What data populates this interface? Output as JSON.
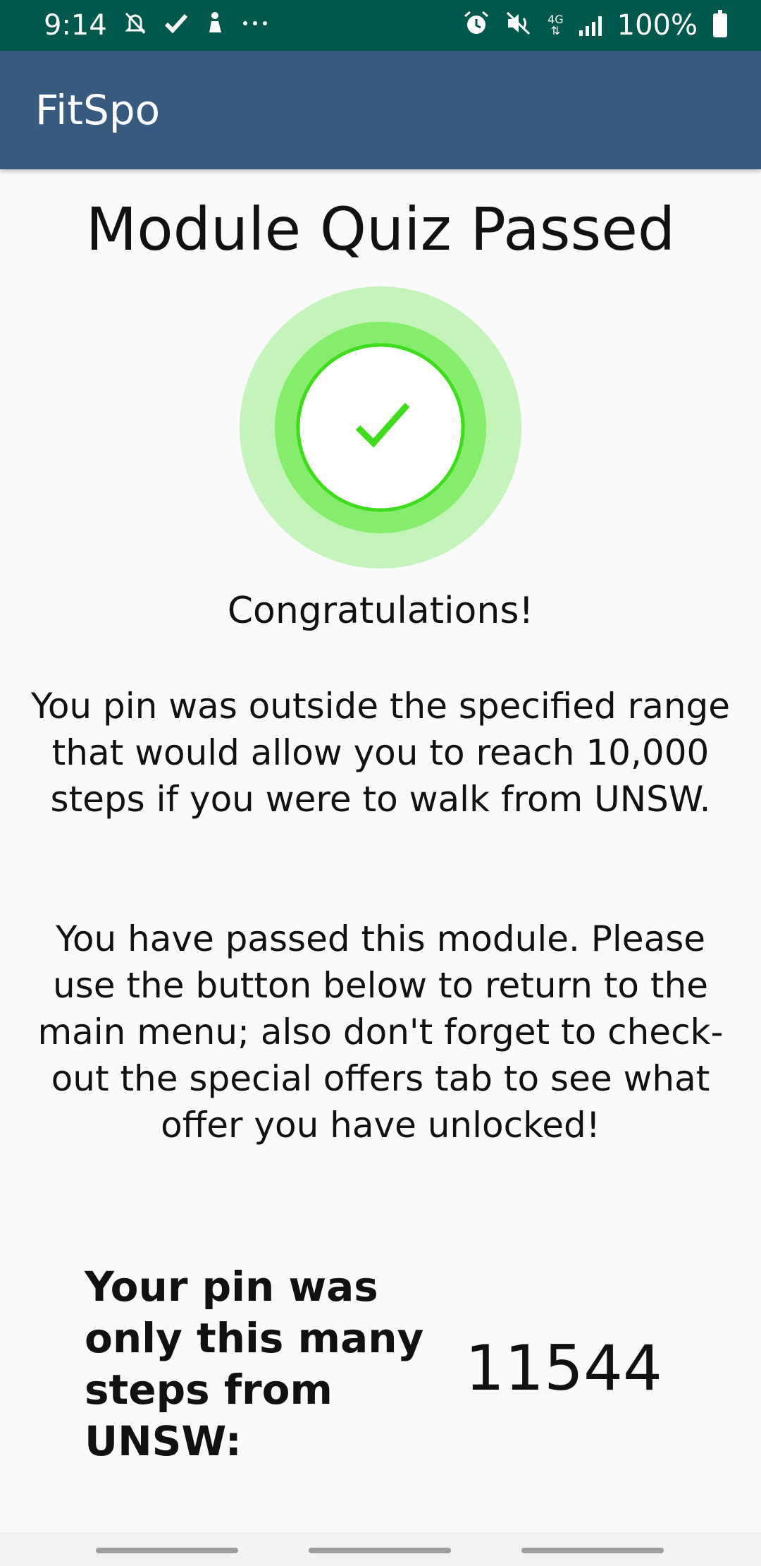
{
  "status_bar": {
    "time": "9:14",
    "left_icons": [
      "notifications-off-icon",
      "check-icon",
      "accessibility-icon",
      "more-icon"
    ],
    "right_icons": [
      "alarm-icon",
      "vibrate-icon",
      "network-4g-icon",
      "signal-icon",
      "battery-icon"
    ],
    "network_label": "4G",
    "battery": "100%"
  },
  "app_bar": {
    "title": "FitSpo"
  },
  "main": {
    "title": "Module Quiz Passed",
    "badge_icon": "check-icon",
    "congrats": "Congratulations!",
    "paragraph_1": "You pin was outside the specified range that would allow you to reach 10,000 steps if you were to walk from UNSW.",
    "paragraph_2": "You have passed this module. Please use the button below to return to the main menu; also don't forget to check-out the special offers tab to see what offer you have unlocked!",
    "steps_label": "Your pin was only this many steps from UNSW:",
    "steps_value": "11544"
  },
  "colors": {
    "status_bar": "#00574b",
    "app_bar": "#375a7f",
    "badge_outer": "#c4f4b9",
    "badge_middle": "#86ec6b",
    "badge_ring": "#3fdc1e",
    "check": "#3fdc1e"
  }
}
